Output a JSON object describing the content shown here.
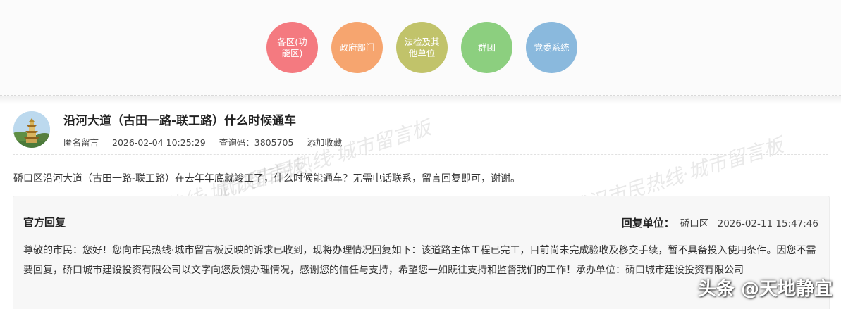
{
  "categories": [
    {
      "label": "各区(功能区)",
      "color": "#f47a80"
    },
    {
      "label": "政府部门",
      "color": "#f6a56f"
    },
    {
      "label": "法检及其他单位",
      "color": "#c1c36a"
    },
    {
      "label": "群团",
      "color": "#8ccf7f"
    },
    {
      "label": "党委系统",
      "color": "#8ab9dd"
    }
  ],
  "post": {
    "title": "沿河大道（古田一路-联工路）什么时候通车",
    "author": "匿名留言",
    "datetime": "2026-02-04 10:25:29",
    "query_code_label": "查询码：",
    "query_code": "3805705",
    "favorite_label": "添加收藏",
    "content": "硚口区沿河大道（古田一路-联工路）在去年年底就竣工了，什么时候能通车？无需电话联系，留言回复即可，谢谢。"
  },
  "reply": {
    "label": "官方回复",
    "unit_label": "回复单位：",
    "unit": "硚口区",
    "datetime": "2026-02-11 15:47:46",
    "content": "尊敬的市民：您好！您向市民热线·城市留言板反映的诉求已收到，现将办理情况回复如下：该道路主体工程已完工，目前尚未完成验收及移交手续，暂不具备投入使用条件。因您不需要回复，硚口城市建设投资有限公司以文字向您反馈办理情况，感谢您的信任与支持，希望您一如既往支持和监督我们的工作！承办单位：硚口城市建设投资有限公司"
  },
  "watermarks": {
    "wm1": "武汉市民热线·城市留言板",
    "wm2": "武汉市民热线·城市留言板",
    "wm3": "武汉市民热线·城市留言板",
    "corner": "头条 @天地静宜"
  }
}
